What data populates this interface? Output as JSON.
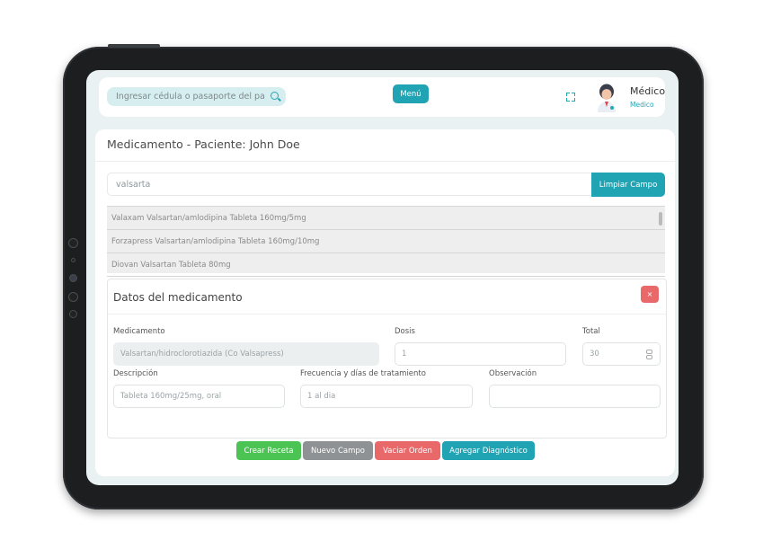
{
  "header": {
    "search_placeholder": "Ingresar cédula o pasaporte del paciente",
    "menu_label": "Menú",
    "user_name": "Médico",
    "user_role": "Medico"
  },
  "card": {
    "title": "Medicamento - Paciente: John Doe",
    "medication_search_value": "valsarta",
    "clear_button": "Limpiar Campo",
    "results": [
      "Valaxam Valsartan/amlodipina Tableta 160mg/5mg",
      "Forzapress Valsartan/amlodipina Tableta 160mg/10mg",
      "Diovan Valsartan Tableta 80mg"
    ]
  },
  "details": {
    "title": "Datos del medicamento",
    "close_label": "×",
    "labels": {
      "medicamento": "Medicamento",
      "dosis": "Dosis",
      "total": "Total",
      "descripcion": "Descripción",
      "frecuencia": "Frecuencia y días de tratamiento",
      "observacion": "Observación"
    },
    "values": {
      "medicamento": "Valsartan/hidroclorotiazida (Co Valsapress)",
      "dosis": "1",
      "total": "30",
      "descripcion": "Tableta  160mg/25mg, oral",
      "frecuencia": "1 al dia",
      "observacion": ""
    }
  },
  "actions": {
    "crear": "Crear Receta",
    "nuevo": "Nuevo Campo",
    "vaciar": "Vaciar Orden",
    "agregar": "Agregar Diagnóstico"
  },
  "colors": {
    "accent": "#20a3b3",
    "success": "#4cc453",
    "neutral": "#8f9294",
    "danger": "#e9686a"
  }
}
